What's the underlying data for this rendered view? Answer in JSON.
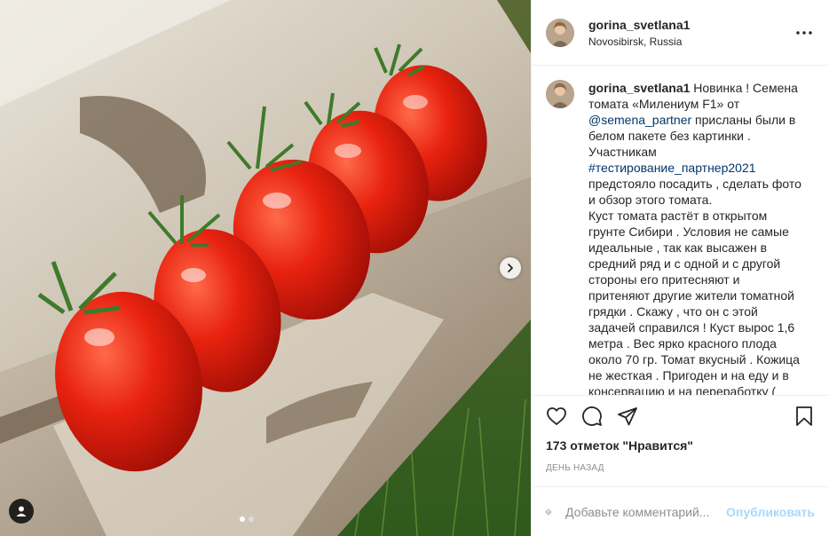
{
  "post": {
    "username": "gorina_svetlana1",
    "location": "Novosibirsk, Russia",
    "caption": {
      "username": "gorina_svetlana1",
      "text_1": " Новинка ! Семена томата «Милениум F1» от ",
      "mention": "@semena_partner",
      "text_2": " присланы были в белом пакете без картинки . Участникам ",
      "hashtag": "#тестирование_партнер2021",
      "text_3": " предстояло посадить , сделать фото и обзор этого томата.",
      "text_4": "Куст томата растёт в открытом грунте Сибири . Условия не самые идеальные , так как высажен в средний ряд и с одной и с другой стороны его притесняют и притеняют другие жители томатной грядки . Скажу , что он с этой задачей справился ! Куст вырос 1,6 метра . Вес ярко красного плода около 70 гр. Томат вкусный . Кожица не жесткая . Пригоден и на еду и в консервацию и на переработку ("
    },
    "likes": "173 отметок \"Нравится\"",
    "timestamp": "День назад",
    "comment_placeholder": "Добавьте комментарий...",
    "publish_label": "Опубликовать"
  },
  "icons": {
    "more": "more-options-icon",
    "like": "heart-icon",
    "comment": "comment-icon",
    "share": "share-icon",
    "save": "bookmark-icon",
    "emoji": "emoji-icon",
    "next": "chevron-right-icon",
    "tags": "user-tag-icon"
  },
  "colors": {
    "link": "#00376b",
    "publish": "#0095f6",
    "muted": "#8e8e8e",
    "border": "#efefef"
  },
  "carousel": {
    "slides": 2,
    "active": 1
  }
}
